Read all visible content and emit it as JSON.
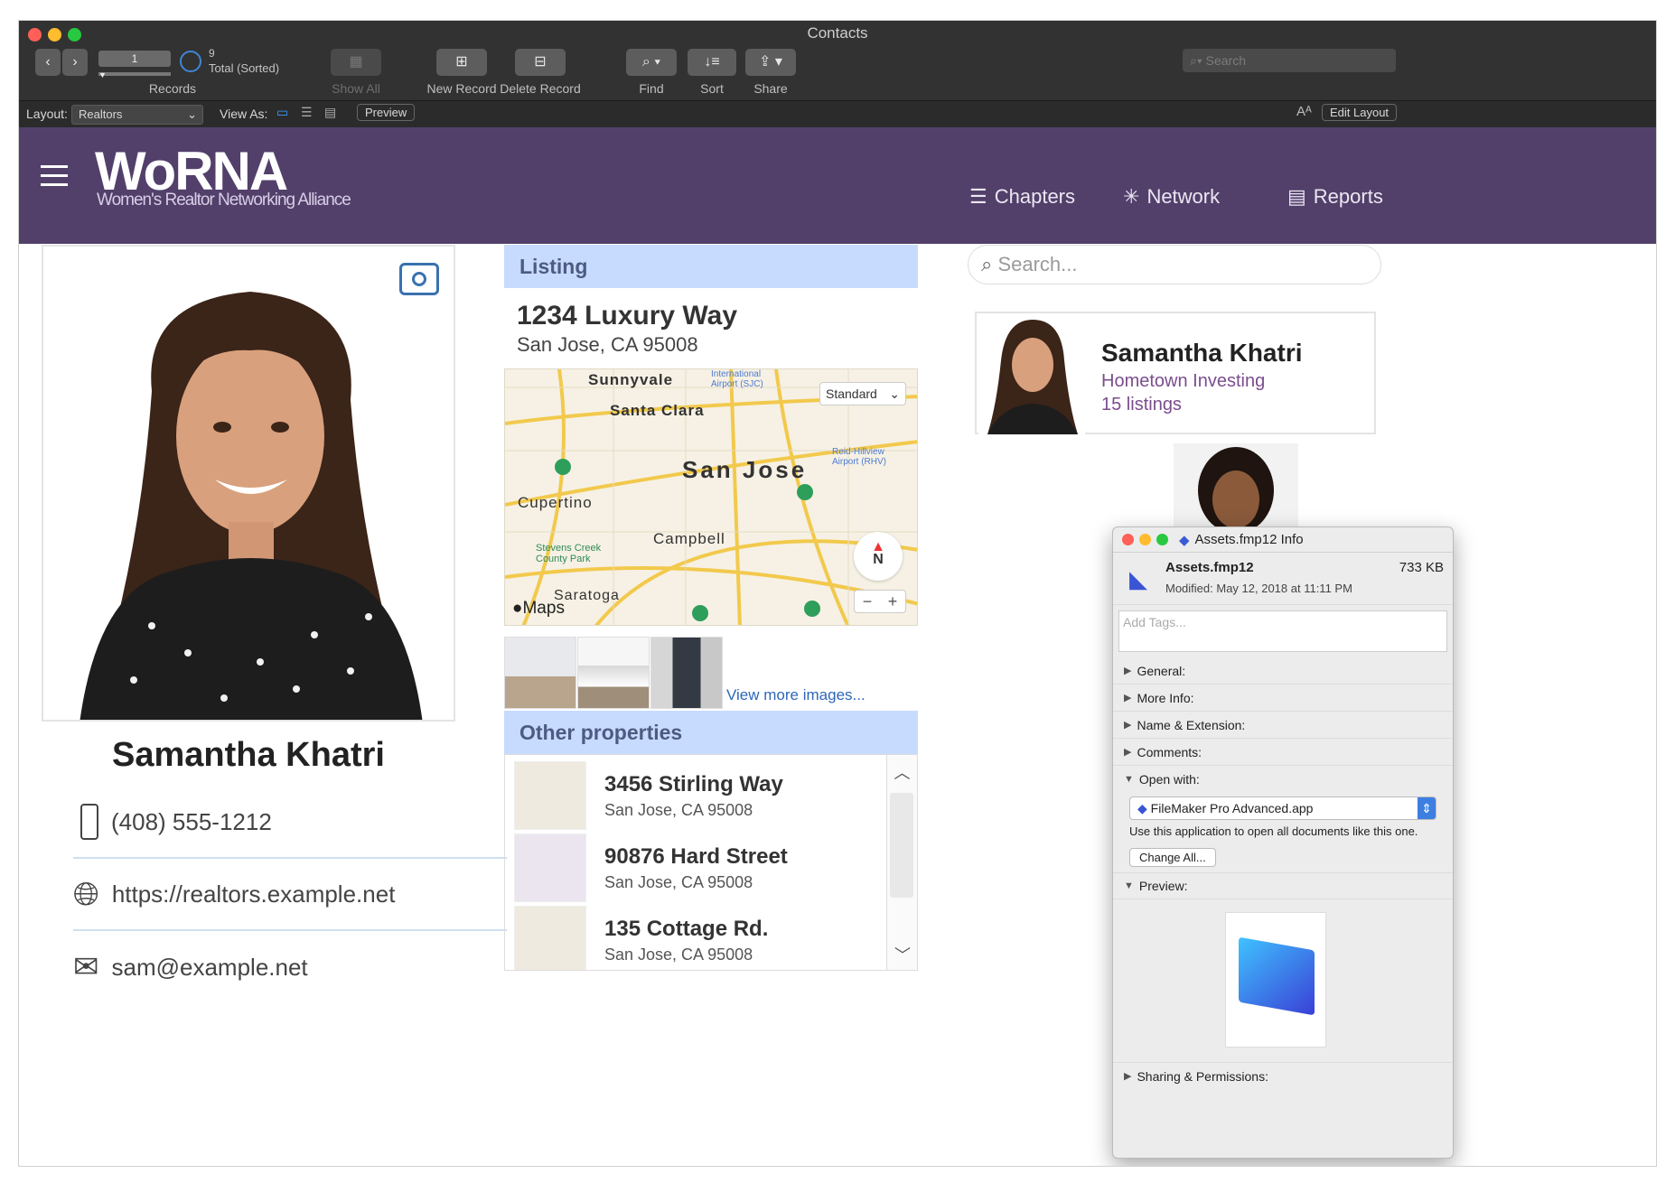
{
  "window": {
    "title": "Contacts"
  },
  "toolbar": {
    "record_current": "1",
    "record_count": "9",
    "record_status": "Total (Sorted)",
    "records_label": "Records",
    "show_all_label": "Show All",
    "new_record_label": "New Record",
    "delete_record_label": "Delete Record",
    "find_label": "Find",
    "sort_label": "Sort",
    "share_label": "Share",
    "search_placeholder": "Search"
  },
  "layout_bar": {
    "layout_label": "Layout:",
    "layout_value": "Realtors",
    "view_as_label": "View As:",
    "preview_label": "Preview",
    "font_icon_label": "Aᴬ",
    "edit_layout_label": "Edit Layout"
  },
  "brand": {
    "logo": "WoRNA",
    "tagline": "Women's Realtor Networking Alliance",
    "header_color": "#52406b"
  },
  "nav": {
    "chapters": "Chapters",
    "network": "Network",
    "reports": "Reports"
  },
  "profile": {
    "name": "Samantha Khatri",
    "phone": "(408) 555-1212",
    "website": "https://realtors.example.net",
    "email": "sam@example.net"
  },
  "listing": {
    "heading": "Listing",
    "street": "1234 Luxury Way",
    "city": "San Jose, CA 95008",
    "map_mode": "Standard",
    "map_brand": "Maps",
    "map_labels": {
      "sunnyvale": "Sunnyvale",
      "santa_clara": "Santa Clara",
      "san_jose": "San Jose",
      "cupertino": "Cupertino",
      "campbell": "Campbell",
      "saratoga": "Saratoga",
      "stevens_creek": "Stevens Creek County Park",
      "airport_sjc": "International Airport (SJC)",
      "reid_hillview": "Reid-Hillview Airport (RHV)",
      "compass": "N"
    },
    "view_more": "View more images..."
  },
  "other_properties": {
    "heading": "Other properties",
    "items": [
      {
        "street": "3456 Stirling Way",
        "city": "San Jose, CA 95008"
      },
      {
        "street": "90876 Hard Street",
        "city": "San Jose, CA 95008"
      },
      {
        "street": "135 Cottage Rd.",
        "city": "San Jose, CA 95008"
      }
    ]
  },
  "search": {
    "placeholder": "Search..."
  },
  "featured": {
    "name": "Samantha Khatri",
    "company": "Hometown Investing",
    "listings": "15 listings"
  },
  "info_window": {
    "title": "Assets.fmp12 Info",
    "filename": "Assets.fmp12",
    "size": "733 KB",
    "modified": "Modified: May 12, 2018 at 11:11 PM",
    "tags_placeholder": "Add Tags...",
    "sections": {
      "general": "General:",
      "more_info": "More Info:",
      "name_ext": "Name & Extension:",
      "comments": "Comments:",
      "open_with": "Open with:",
      "preview": "Preview:",
      "sharing": "Sharing & Permissions:"
    },
    "app": "FileMaker Pro Advanced.app",
    "open_with_note": "Use this application to open all documents like this one.",
    "change_all": "Change All..."
  }
}
